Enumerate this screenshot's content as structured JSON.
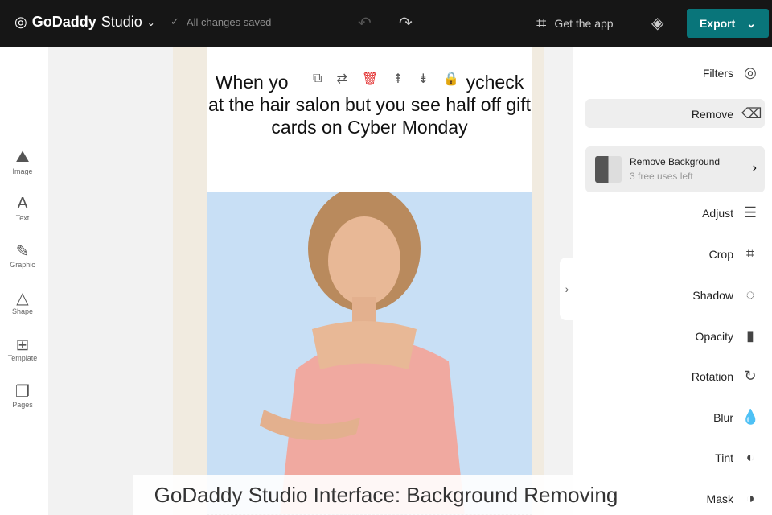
{
  "topbar": {
    "brand_bold": "GoDaddy",
    "brand_light": "Studio",
    "status": "All changes saved",
    "get_app": "Get the app",
    "export": "Export"
  },
  "left_tools": [
    {
      "label": "Image",
      "icon": "image-icon"
    },
    {
      "label": "Text",
      "icon": "text-icon"
    },
    {
      "label": "Graphic",
      "icon": "graphic-icon"
    },
    {
      "label": "Shape",
      "icon": "shape-icon"
    },
    {
      "label": "Template",
      "icon": "template-icon"
    },
    {
      "label": "Pages",
      "icon": "pages-icon"
    }
  ],
  "canvas": {
    "headline": "When you ... your paycheck at the hair salon but you see half off gift cards on Cyber Monday",
    "headline_visible": "When yo       your paycheck at the hair salon but you see half off gift cards on Cyber Monday"
  },
  "right_panel": {
    "filters": "Filters",
    "remove": "Remove",
    "remove_bg_title": "Remove Background",
    "remove_bg_sub": "3 free uses left",
    "adjust": "Adjust",
    "crop": "Crop",
    "shadow": "Shadow",
    "opacity": "Opacity",
    "rotation": "Rotation",
    "blur": "Blur",
    "tint": "Tint",
    "mask": "Mask"
  },
  "caption": "GoDaddy Studio Interface: Background Removing",
  "colors": {
    "accent": "#09757a",
    "photo_bg": "#c8dff5",
    "delete": "#e02020"
  }
}
